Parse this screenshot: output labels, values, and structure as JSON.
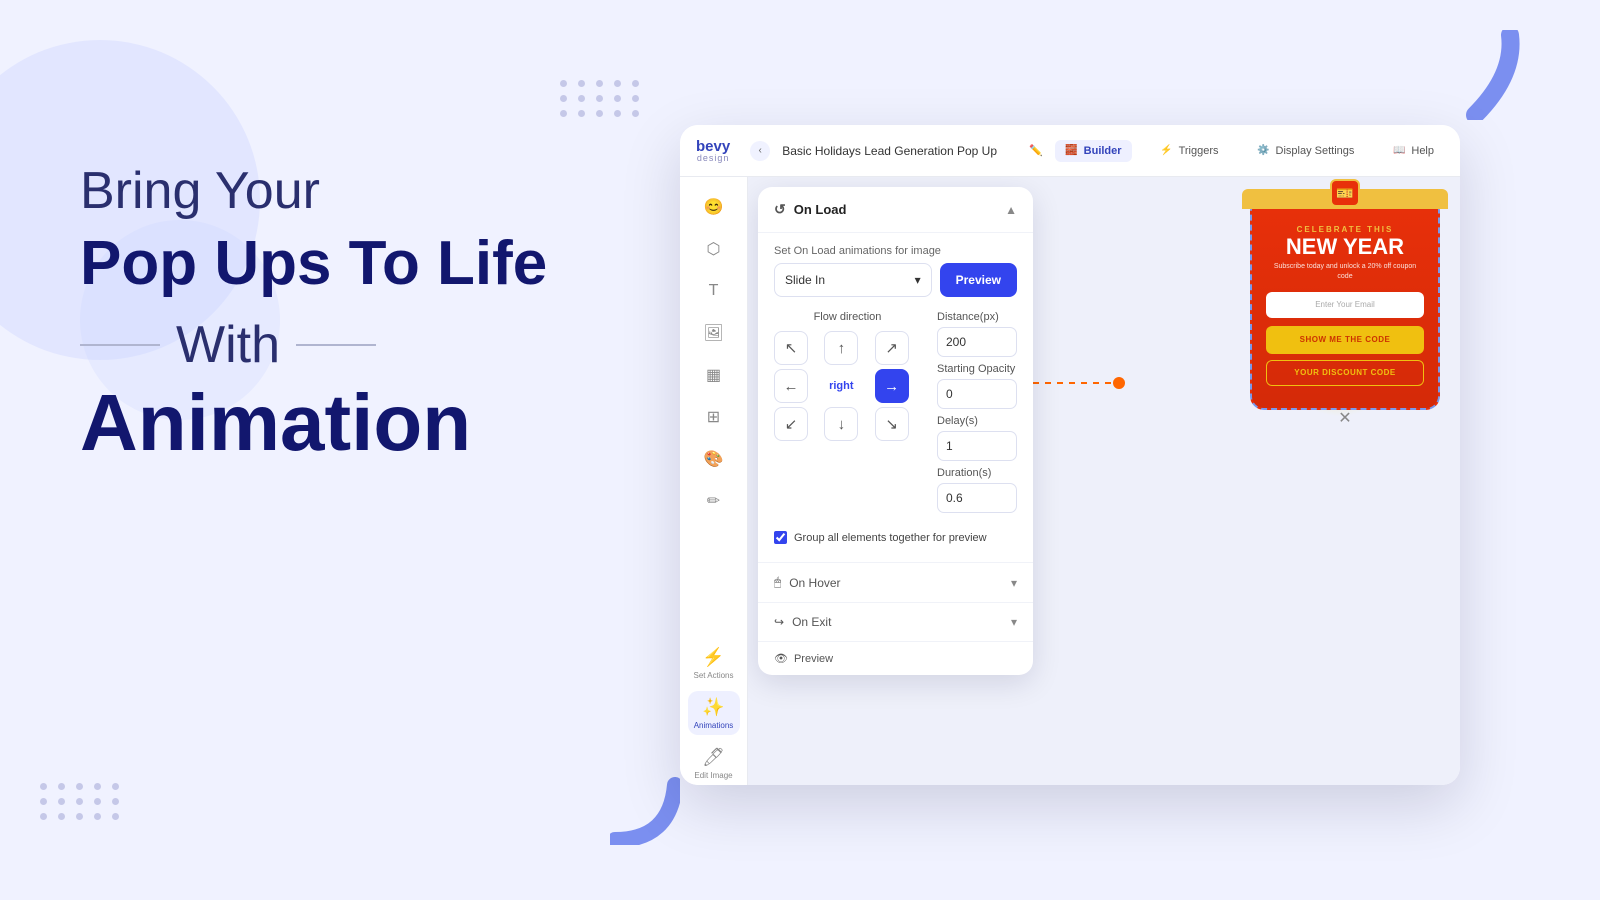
{
  "page": {
    "background_color": "#f0f2ff"
  },
  "left_section": {
    "line1": "Bring Your",
    "line2": "Pop Ups To Life",
    "line3": "With",
    "line4": "Animation"
  },
  "topbar": {
    "logo_bevy": "bevy",
    "logo_design": "design",
    "page_title": "Basic Holidays Lead Generation Pop Up",
    "btn_builder": "Builder",
    "btn_triggers": "Triggers",
    "btn_display": "Display Settings",
    "btn_help": "Help"
  },
  "sidebar": {
    "set_actions_label": "Set Actions",
    "animations_label": "Animations",
    "edit_image_label": "Edit Image"
  },
  "anim_panel": {
    "on_load_label": "On Load",
    "field_label": "Set On Load animations for image",
    "select_value": "Slide In",
    "preview_btn": "Preview",
    "flow_direction_label": "Flow direction",
    "distance_label": "Distance(px)",
    "distance_value": "200",
    "opacity_label": "Starting Opacity",
    "opacity_value": "0",
    "delay_label": "Delay(s)",
    "delay_value": "1",
    "duration_label": "Duration(s)",
    "duration_value": "0.6",
    "checkbox_label": "Group all elements together for preview",
    "on_hover_label": "On Hover",
    "on_exit_label": "On Exit",
    "preview_bar_label": "Preview",
    "direction_center": "right",
    "arrows": [
      {
        "dir": "nw",
        "symbol": "↖",
        "active": false
      },
      {
        "dir": "n",
        "symbol": "↑",
        "active": false
      },
      {
        "dir": "ne",
        "symbol": "↗",
        "active": false
      },
      {
        "dir": "w",
        "symbol": "←",
        "active": false
      },
      {
        "dir": "center",
        "symbol": "right",
        "active": true
      },
      {
        "dir": "e",
        "symbol": "→",
        "active": true
      },
      {
        "dir": "sw",
        "symbol": "↙",
        "active": false
      },
      {
        "dir": "s",
        "symbol": "↓",
        "active": false
      },
      {
        "dir": "se",
        "symbol": "↘",
        "active": false
      }
    ]
  },
  "popup": {
    "celebrate_text": "CELEBRATE THIS",
    "new_year_text": "NEW YEAR",
    "subtitle": "Subscribe today and unlock a\n20% off coupon code",
    "email_placeholder": "Enter Your Email",
    "cta_btn": "SHOW ME THE CODE",
    "discount_btn": "YOUR DISCOUNT CODE"
  },
  "dots": {
    "count": 15
  }
}
